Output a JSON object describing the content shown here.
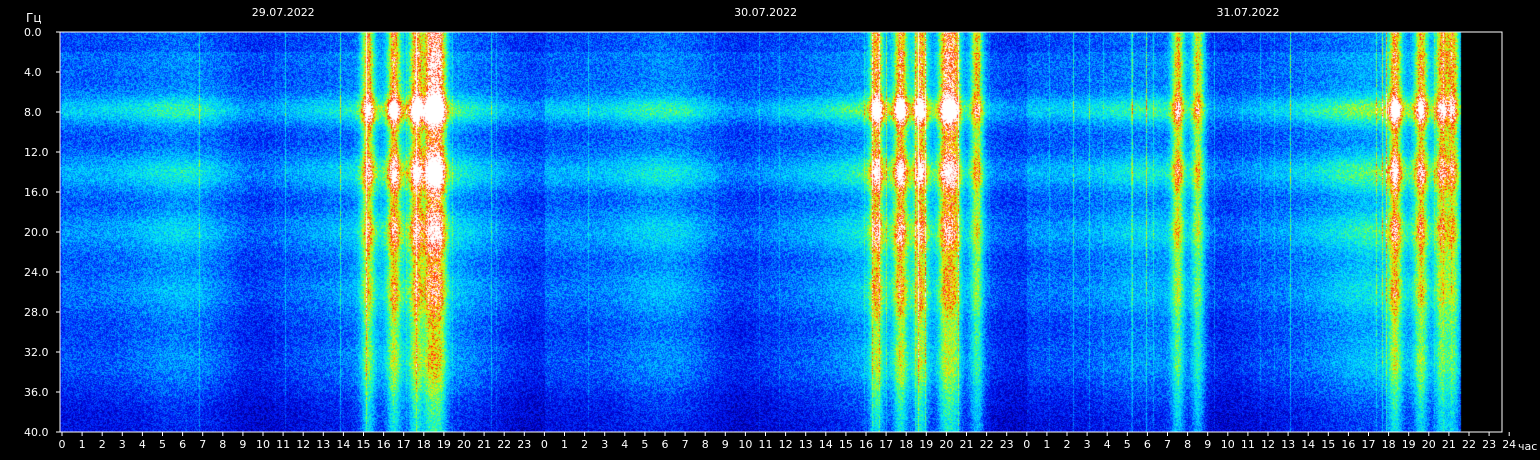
{
  "chart_data": {
    "type": "heatmap",
    "title": "",
    "ylabel": "Гц",
    "xlabel": "час",
    "ylim": [
      0,
      40
    ],
    "y_ticks": [
      "0.0",
      "4.0",
      "8.0",
      "12.0",
      "16.0",
      "20.0",
      "24.0",
      "28.0",
      "32.0",
      "36.0",
      "40.0"
    ],
    "x_ticks": [
      "0",
      "1",
      "2",
      "3",
      "4",
      "5",
      "6",
      "7",
      "8",
      "9",
      "10",
      "11",
      "12",
      "13",
      "14",
      "15",
      "16",
      "17",
      "18",
      "19",
      "20",
      "21",
      "22",
      "23",
      "0",
      "1",
      "2",
      "3",
      "4",
      "5",
      "6",
      "7",
      "8",
      "9",
      "10",
      "11",
      "12",
      "13",
      "14",
      "15",
      "16",
      "17",
      "18",
      "19",
      "20",
      "21",
      "22",
      "23",
      "0",
      "1",
      "2",
      "3",
      "4",
      "5",
      "6",
      "7",
      "8",
      "9",
      "10",
      "11",
      "12",
      "13",
      "14",
      "15",
      "16",
      "17",
      "18",
      "19",
      "20",
      "21",
      "22",
      "23",
      "24"
    ],
    "dates": [
      {
        "label": "29.07.2022",
        "hour": 12
      },
      {
        "label": "30.07.2022",
        "hour": 36
      },
      {
        "label": "31.07.2022",
        "hour": 60
      }
    ],
    "x_range_hours": [
      0,
      72
    ],
    "data_end_hour": 69.6,
    "frequency_bands_hz": [
      7.8,
      14.1,
      20.0,
      26.0,
      33.0
    ],
    "colormap": [
      "#000080",
      "#0000ff",
      "#00a0ff",
      "#00ffff",
      "#00ff80",
      "#c0ff00",
      "#ff0000",
      "#ffffff"
    ],
    "legend": "none",
    "grid": false
  }
}
